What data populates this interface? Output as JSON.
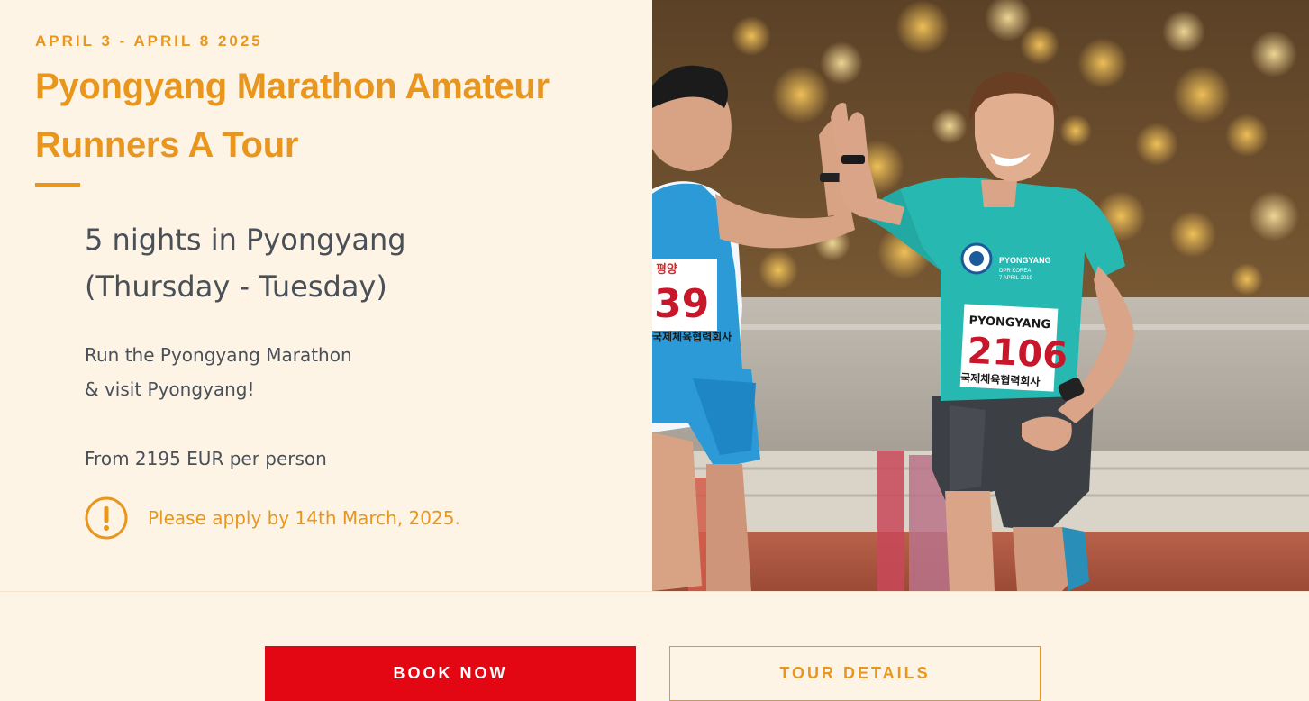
{
  "tour": {
    "dates": "APRIL 3 - APRIL 8 2025",
    "title": "Pyongyang Marathon Amateur Runners A Tour",
    "nights_line1": "5 nights in Pyongyang",
    "nights_line2": "(Thursday - Tuesday)",
    "blurb_line1": "Run the Pyongyang Marathon",
    "blurb_line2": "& visit Pyongyang!",
    "price": "From 2195 EUR per person",
    "deadline": "Please apply by 14th March, 2025.",
    "deadline_icon": "exclamation-circle-icon"
  },
  "photo": {
    "runner_left_bib": "39",
    "runner_left_bib_top": "평양",
    "runner_right_bib": "2106",
    "runner_right_bib_top": "PYONGYANG",
    "bib_bottom": "국제체육협력회사",
    "shirt_text_1": "PYONGYANG",
    "shirt_text_2": "DPR KOREA",
    "shirt_text_3": "7 APRIL 2019"
  },
  "actions": {
    "book_label": "BOOK NOW",
    "details_label": "TOUR DETAILS"
  },
  "colors": {
    "accent": "#e8961e",
    "background": "#fdf4e6",
    "body_text": "#4a5058",
    "book_button": "#e30613"
  }
}
